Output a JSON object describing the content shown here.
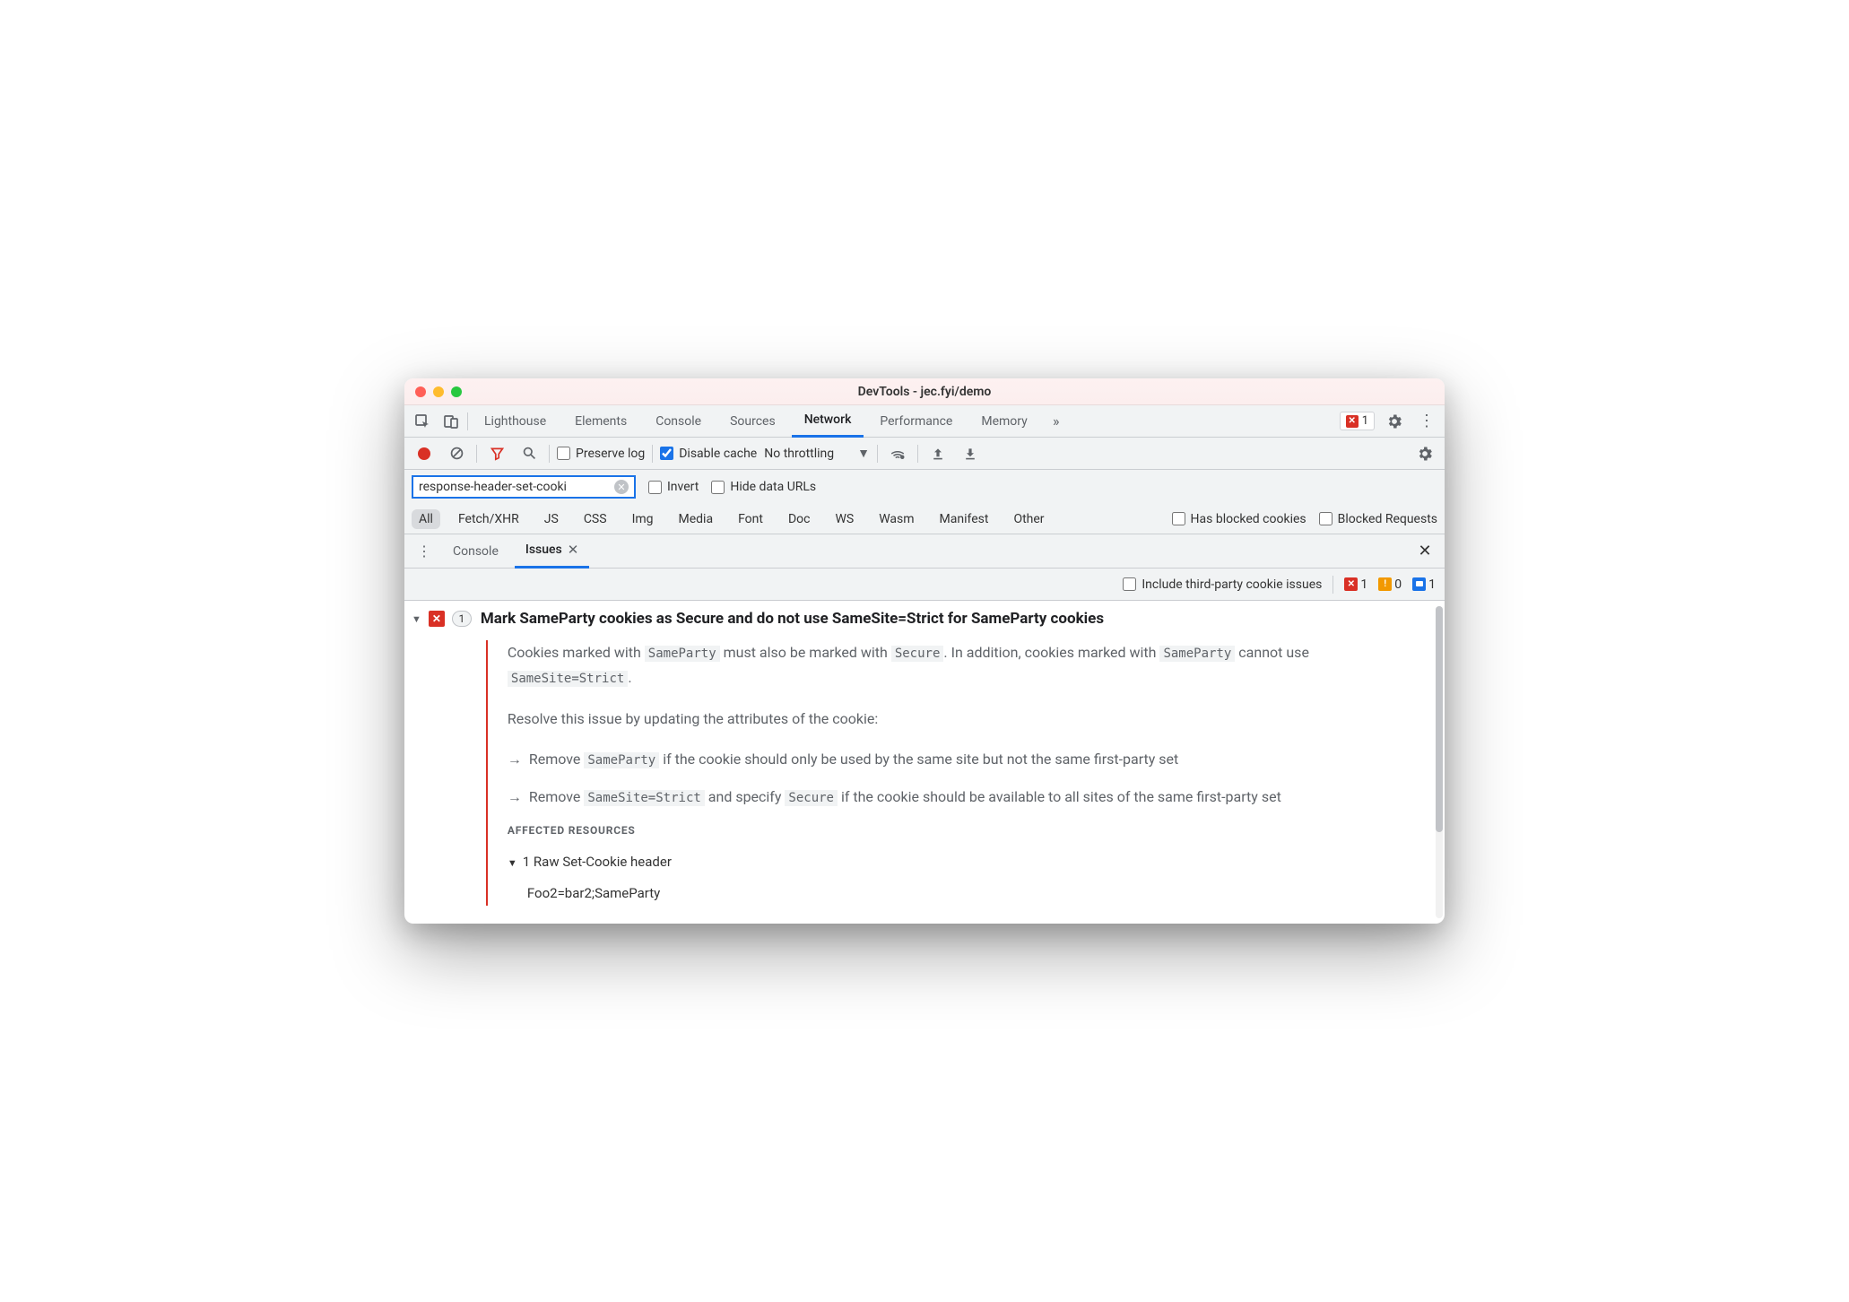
{
  "window": {
    "title": "DevTools - jec.fyi/demo"
  },
  "tabs": {
    "items": [
      "Lighthouse",
      "Elements",
      "Console",
      "Sources",
      "Network",
      "Performance",
      "Memory"
    ],
    "active": "Network",
    "errors_count": "1"
  },
  "toolbar": {
    "preserve_log": "Preserve log",
    "disable_cache": "Disable cache",
    "throttling": "No throttling"
  },
  "filter": {
    "value": "response-header-set-cooki",
    "invert": "Invert",
    "hide_data_urls": "Hide data URLs"
  },
  "types": {
    "items": [
      "All",
      "Fetch/XHR",
      "JS",
      "CSS",
      "Img",
      "Media",
      "Font",
      "Doc",
      "WS",
      "Wasm",
      "Manifest",
      "Other"
    ],
    "active": "All",
    "has_blocked": "Has blocked cookies",
    "blocked_requests": "Blocked Requests"
  },
  "drawer": {
    "tabs": [
      "Console",
      "Issues"
    ],
    "active": "Issues"
  },
  "issues_bar": {
    "include_third_party": "Include third-party cookie issues",
    "counts": {
      "error": "1",
      "warning": "0",
      "info": "1"
    }
  },
  "issue": {
    "count": "1",
    "title": "Mark SameParty cookies as Secure and do not use SameSite=Strict for SameParty cookies",
    "p1_a": "Cookies marked with ",
    "p1_code1": "SameParty",
    "p1_b": " must also be marked with ",
    "p1_code2": "Secure",
    "p1_c": ". In addition, cookies marked with ",
    "p1_code3": "SameParty",
    "p1_d": " cannot use ",
    "p1_code4": "SameSite=Strict",
    "p1_e": ".",
    "p2": "Resolve this issue by updating the attributes of the cookie:",
    "b1_a": "Remove ",
    "b1_code": "SameParty",
    "b1_b": " if the cookie should only be used by the same site but not the same first-party set",
    "b2_a": "Remove ",
    "b2_code1": "SameSite=Strict",
    "b2_b": " and specify ",
    "b2_code2": "Secure",
    "b2_c": " if the cookie should be available to all sites of the same first-party set",
    "affected_heading": "AFFECTED RESOURCES",
    "resource_count": "1 Raw Set-Cookie header",
    "resource_value": "Foo2=bar2;SameParty"
  }
}
